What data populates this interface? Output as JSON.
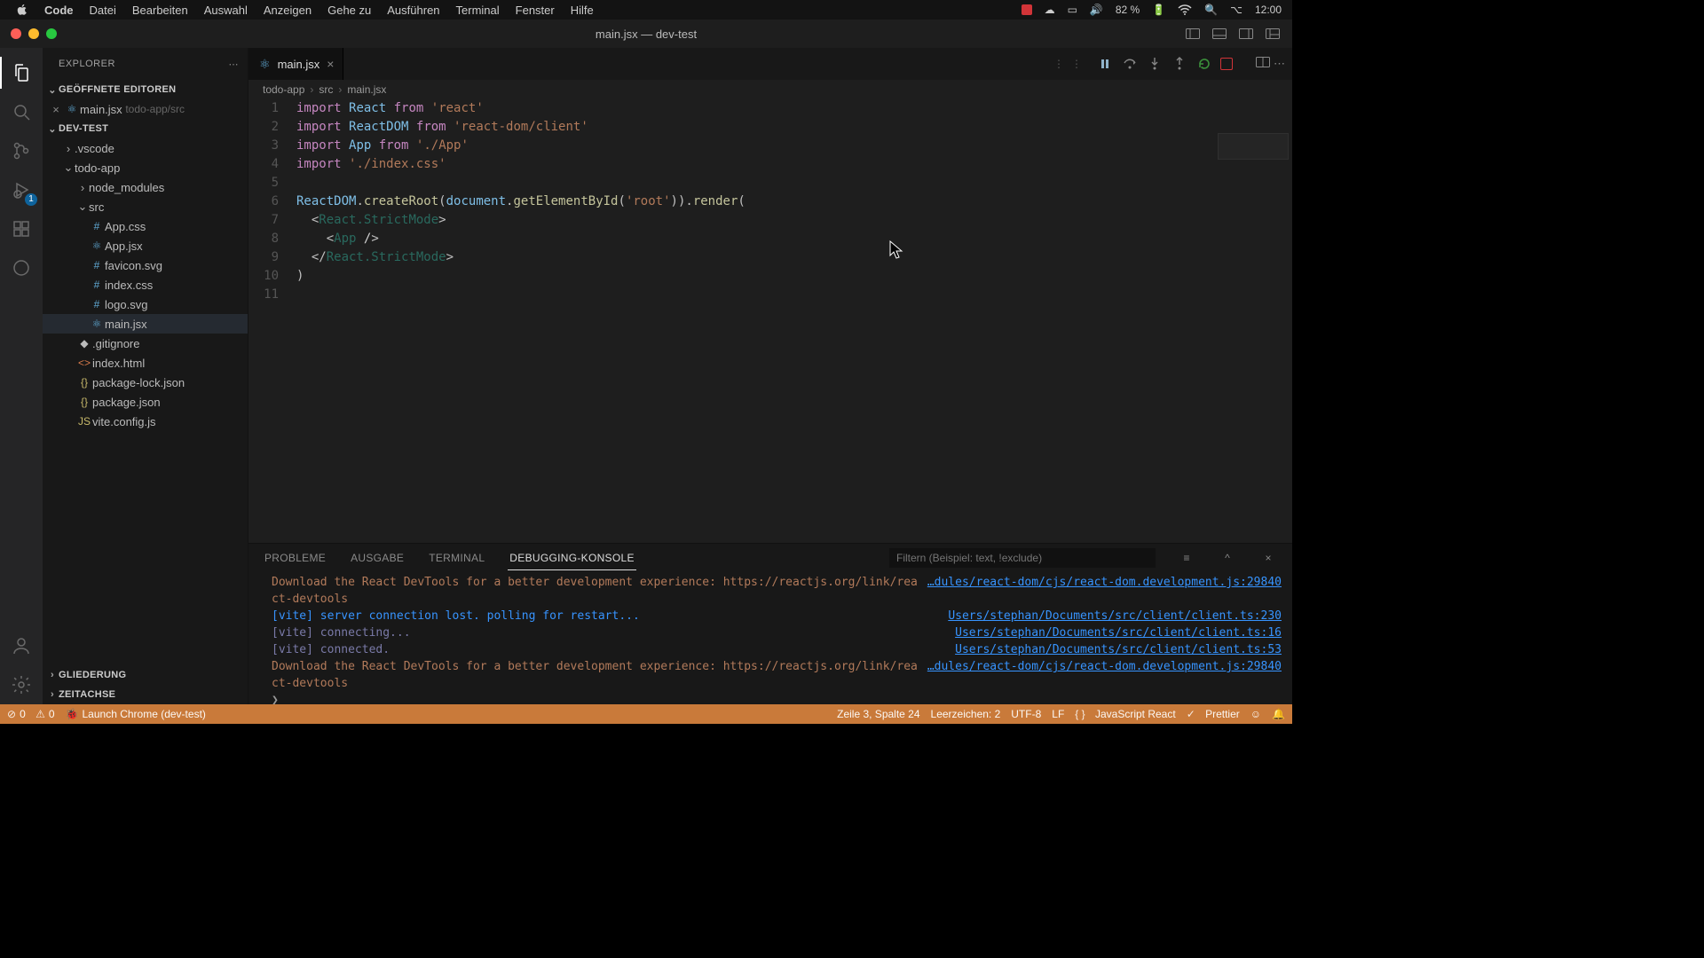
{
  "macos_menu": {
    "app": "Code",
    "items": [
      "Datei",
      "Bearbeiten",
      "Auswahl",
      "Anzeigen",
      "Gehe zu",
      "Ausführen",
      "Terminal",
      "Fenster",
      "Hilfe"
    ],
    "battery": "82 %",
    "time": "12:00"
  },
  "window": {
    "title": "main.jsx — dev-test"
  },
  "explorer": {
    "title": "EXPLORER",
    "open_editors_label": "GEÖFFNETE EDITOREN",
    "open_editors": [
      {
        "close": "×",
        "icon": "react-icon",
        "name": "main.jsx",
        "hint": "todo-app/src"
      }
    ],
    "workspace": "DEV-TEST",
    "tree": [
      {
        "indent": 1,
        "type": "folder",
        "open": false,
        "name": ".vscode"
      },
      {
        "indent": 1,
        "type": "folder",
        "open": true,
        "name": "todo-app"
      },
      {
        "indent": 2,
        "type": "folder",
        "open": false,
        "name": "node_modules"
      },
      {
        "indent": 2,
        "type": "folder",
        "open": true,
        "name": "src"
      },
      {
        "indent": 3,
        "type": "file",
        "icon": "hash",
        "name": "App.css"
      },
      {
        "indent": 3,
        "type": "file",
        "icon": "react",
        "name": "App.jsx"
      },
      {
        "indent": 3,
        "type": "file",
        "icon": "hash",
        "name": "favicon.svg"
      },
      {
        "indent": 3,
        "type": "file",
        "icon": "hash",
        "name": "index.css"
      },
      {
        "indent": 3,
        "type": "file",
        "icon": "hash",
        "name": "logo.svg"
      },
      {
        "indent": 3,
        "type": "file",
        "icon": "react",
        "name": "main.jsx",
        "selected": true
      },
      {
        "indent": 2,
        "type": "file",
        "icon": "dot",
        "name": ".gitignore"
      },
      {
        "indent": 2,
        "type": "file",
        "icon": "html",
        "name": "index.html"
      },
      {
        "indent": 2,
        "type": "file",
        "icon": "json",
        "name": "package-lock.json"
      },
      {
        "indent": 2,
        "type": "file",
        "icon": "json",
        "name": "package.json"
      },
      {
        "indent": 2,
        "type": "file",
        "icon": "js",
        "name": "vite.config.js"
      }
    ],
    "sections": {
      "outline": "GLIEDERUNG",
      "timeline": "ZEITACHSE"
    }
  },
  "tabs": [
    {
      "icon": "react-icon",
      "label": "main.jsx",
      "dirty": false
    }
  ],
  "debug_toolbar": {
    "buttons": [
      "pause",
      "step-over",
      "step-into",
      "step-out",
      "restart",
      "stop"
    ]
  },
  "breadcrumbs": [
    "todo-app",
    "src",
    "main.jsx"
  ],
  "code": {
    "lines": [
      {
        "n": 1,
        "html": "<span class='tok-k'>import</span> <span class='tok-v'>React</span> <span class='tok-k'>from</span> <span class='tok-s'>'react'</span>"
      },
      {
        "n": 2,
        "html": "<span class='tok-k'>import</span> <span class='tok-v'>ReactDOM</span> <span class='tok-k'>from</span> <span class='tok-s'>'react-dom/client'</span>"
      },
      {
        "n": 3,
        "html": "<span class='tok-k'>import</span> <span class='tok-v'>App</span> <span class='tok-k'>from</span> <span class='tok-s'>'./App'</span>"
      },
      {
        "n": 4,
        "html": "<span class='tok-k'>import</span> <span class='tok-s'>'./index.css'</span>"
      },
      {
        "n": 5,
        "html": ""
      },
      {
        "n": 6,
        "html": "<span class='tok-v'>ReactDOM</span>.<span class='tok-f'>createRoot</span>(<span class='tok-v'>document</span>.<span class='tok-f'>getElementById</span>(<span class='tok-s'>'root'</span>)).<span class='tok-f'>render</span>("
      },
      {
        "n": 7,
        "html": "  &lt;<span class='tok-t'>React.StrictMode</span>&gt;"
      },
      {
        "n": 8,
        "html": "    &lt;<span class='tok-t'>App</span> <span class='tok-p'>/</span>&gt;"
      },
      {
        "n": 9,
        "html": "  &lt;/<span class='tok-t'>React.StrictMode</span>&gt;"
      },
      {
        "n": 10,
        "html": ")"
      },
      {
        "n": 11,
        "html": ""
      }
    ]
  },
  "panel": {
    "tabs": {
      "problems": "PROBLEME",
      "output": "AUSGABE",
      "terminal": "TERMINAL",
      "debug": "DEBUGGING-KONSOLE"
    },
    "filter_placeholder": "Filtern (Beispiel: text, !exclude)",
    "lines": [
      {
        "cls": "c-warn",
        "msg": "Download the React DevTools for a better development experience: https://reactjs.org/link/react-devtools",
        "src": "…dules/react-dom/cjs/react-dom.development.js:29840"
      },
      {
        "cls": "c-info",
        "msg": "[vite] server connection lost. polling for restart...",
        "src": "Users/stephan/Documents/src/client/client.ts:230"
      },
      {
        "cls": "c-vite",
        "msg": "[vite] connecting...",
        "src": "Users/stephan/Documents/src/client/client.ts:16"
      },
      {
        "cls": "c-vite",
        "msg": "[vite] connected.",
        "src": "Users/stephan/Documents/src/client/client.ts:53"
      },
      {
        "cls": "c-warn",
        "msg": "Download the React DevTools for a better development experience: https://reactjs.org/link/react-devtools",
        "src": "…dules/react-dom/cjs/react-dom.development.js:29840"
      }
    ],
    "prompt": "❯"
  },
  "statusbar": {
    "errors": "0",
    "warnings": "0",
    "launch": "Launch Chrome (dev-test)",
    "cursor": "Zeile 3, Spalte 24",
    "indent": "Leerzeichen: 2",
    "encoding": "UTF-8",
    "eol": "LF",
    "lang": "JavaScript React",
    "prettier": "Prettier"
  },
  "activitybar": {
    "debug_badge": "1"
  }
}
